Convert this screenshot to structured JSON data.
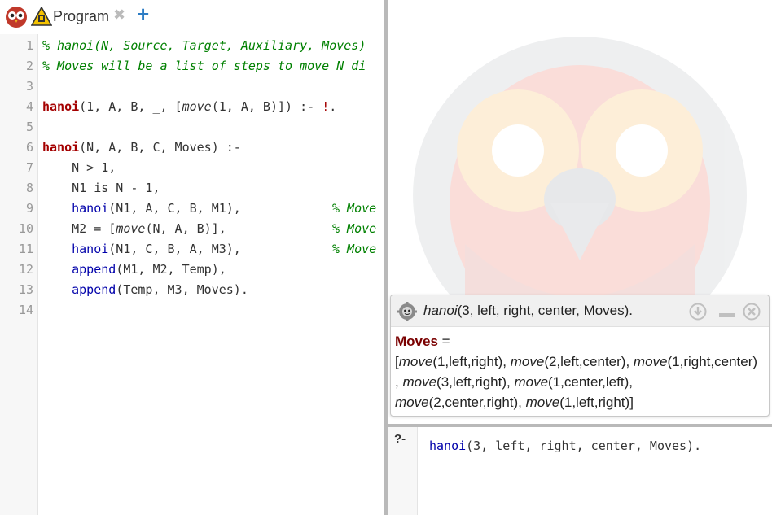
{
  "tab": {
    "label": "Program",
    "close": "✖",
    "add": "+"
  },
  "editor": {
    "line_numbers": [
      "1",
      "2",
      "3",
      "4",
      "5",
      "6",
      "7",
      "8",
      "9",
      "10",
      "11",
      "12",
      "13",
      "14"
    ],
    "l1": "% hanoi(N, Source, Target, Auxiliary, Moves)",
    "l2": "% Moves will be a list of steps to move N di",
    "l4": {
      "head": "hanoi",
      "a": "(1, A, B, _, [",
      "move": "move",
      "b": "(1, A, B)]) :- ",
      "cut": "!",
      "end": "."
    },
    "l6": {
      "head": "hanoi",
      "rest": "(N, A, B, C, Moves) :-"
    },
    "l7": "    N > 1,",
    "l8": "    N1 is N - 1,",
    "l9": {
      "call": "    hanoi",
      "args": "(N1, A, C, B, M1),",
      "comment": "% Move"
    },
    "l10": {
      "a": "    M2 = [",
      "move": "move",
      "b": "(N, A, B)],",
      "comment": "% Move"
    },
    "l11": {
      "call": "    hanoi",
      "args": "(N1, C, B, A, M3),",
      "comment": "% Move"
    },
    "l12": {
      "call": "    append",
      "args": "(M1, M2, Temp),"
    },
    "l13": {
      "call": "    append",
      "args": "(Temp, M3, Moves)."
    }
  },
  "answer": {
    "query_pred": "hanoi",
    "query_rest": "(3, left, right, center, Moves).",
    "var_name": "Moves",
    "eq": " =",
    "line1": [
      {
        "t": "[",
        "i": false
      },
      {
        "t": "move",
        "i": true
      },
      {
        "t": "(1,left,right), ",
        "i": false
      },
      {
        "t": "move",
        "i": true
      },
      {
        "t": "(2,left,center), ",
        "i": false
      },
      {
        "t": "move",
        "i": true
      },
      {
        "t": "(1,right,center)",
        "i": false
      }
    ],
    "line2": [
      {
        "t": ", ",
        "i": false
      },
      {
        "t": "move",
        "i": true
      },
      {
        "t": "(3,left,right), ",
        "i": false
      },
      {
        "t": "move",
        "i": true
      },
      {
        "t": "(1,center,left),",
        "i": false
      }
    ],
    "line3": [
      {
        "t": "move",
        "i": true
      },
      {
        "t": "(2,center,right), ",
        "i": false
      },
      {
        "t": "move",
        "i": true
      },
      {
        "t": "(1,left,right)]",
        "i": false
      }
    ]
  },
  "query": {
    "prompt": "?-",
    "pred": "hanoi",
    "rest": "(3, left, right, center, Moves)."
  },
  "colors": {
    "accent": "#2c7cc4",
    "head": "#a40000",
    "comment": "#008000",
    "goal": "#0000aa"
  }
}
